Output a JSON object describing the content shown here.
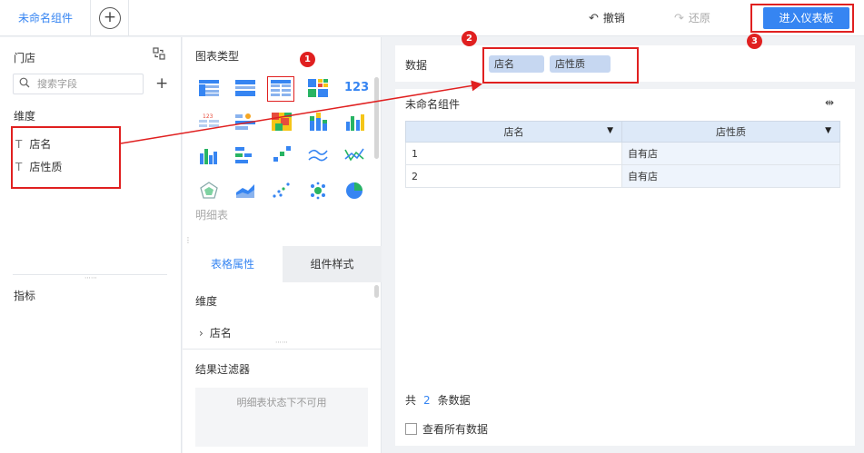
{
  "topbar": {
    "tab_label": "未命名组件",
    "add_tab_symbol": "+",
    "undo_label": "撤销",
    "redo_label": "还原",
    "enter_dashboard_label": "进入仪表板"
  },
  "left_panel": {
    "datasource_title": "门店",
    "search_placeholder": "搜索字段",
    "dimension_label": "维度",
    "dimension_fields": [
      {
        "type_icon": "T",
        "label": "店名"
      },
      {
        "type_icon": "T",
        "label": "店性质"
      }
    ],
    "metric_label": "指标"
  },
  "middle_panel": {
    "chart_type_title": "图表类型",
    "detail_table_label": "明细表",
    "tabs": [
      "表格属性",
      "组件样式"
    ],
    "property_dimension_label": "维度",
    "property_dimension_item": "店名",
    "result_filter_title": "结果过滤器",
    "result_filter_placeholder": "明细表状态下不可用"
  },
  "data_bar": {
    "label": "数据",
    "pills": [
      "店名",
      "店性质"
    ]
  },
  "component": {
    "title": "未命名组件",
    "table": {
      "columns": [
        "店名",
        "店性质"
      ],
      "rows": [
        [
          "1",
          "自有店"
        ],
        [
          "2",
          "自有店"
        ]
      ]
    },
    "count_prefix": "共",
    "count_value": "2",
    "count_suffix": "条数据",
    "view_all_label": "查看所有数据"
  },
  "annotations": [
    "1",
    "2",
    "3"
  ],
  "colors": {
    "accent": "#3685f2",
    "annotation_red": "#e02020",
    "pill_bg": "#c6d7f1",
    "table_header_bg": "#dde9f8"
  }
}
